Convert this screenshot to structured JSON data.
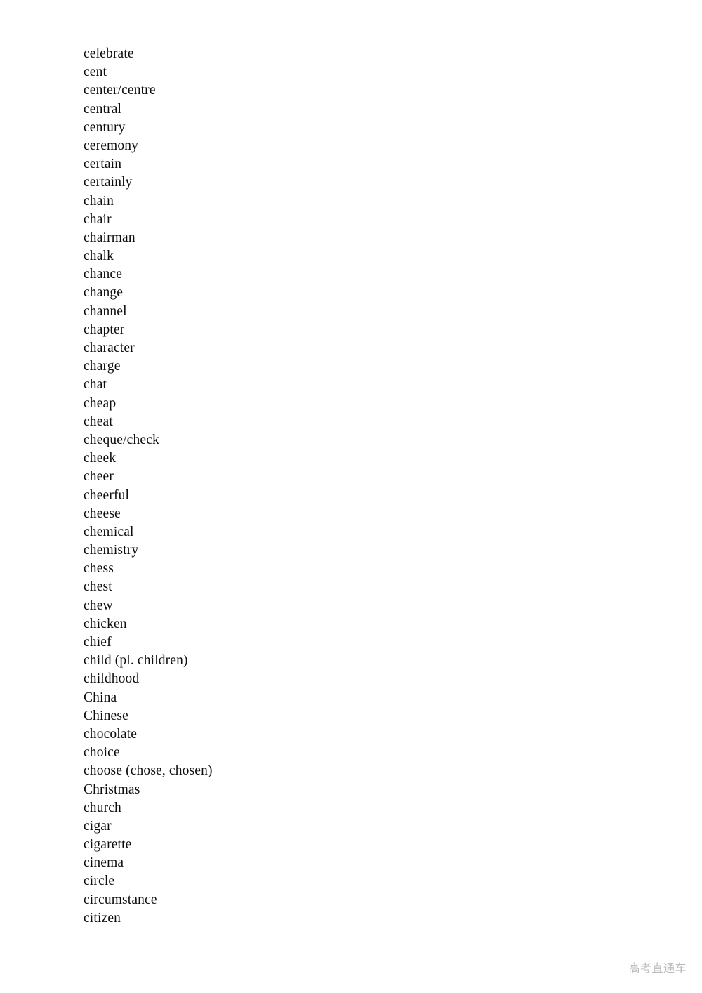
{
  "document": {
    "type": "vocabulary-word-list",
    "page_background": "#ffffff",
    "text_color": "#0d0d0d",
    "words": [
      "celebrate",
      "cent",
      "center/centre",
      "central",
      "century",
      "ceremony",
      "certain",
      "certainly",
      "chain",
      "chair",
      "chairman",
      "chalk",
      "chance",
      "change",
      "channel",
      "chapter",
      "character",
      "charge",
      "chat",
      "cheap",
      "cheat",
      "cheque/check",
      "cheek",
      "cheer",
      "cheerful",
      "cheese",
      "chemical",
      "chemistry",
      "chess",
      "chest",
      "chew",
      "chicken",
      "chief",
      "child (pl. children)",
      "childhood",
      "China",
      "Chinese",
      "chocolate",
      "choice",
      "choose (chose, chosen)",
      "Christmas",
      "church",
      "cigar",
      "cigarette",
      "cinema",
      "circle",
      "circumstance",
      "citizen"
    ]
  },
  "watermark": {
    "text": "高考直通车",
    "color": "#b9b9b9"
  }
}
